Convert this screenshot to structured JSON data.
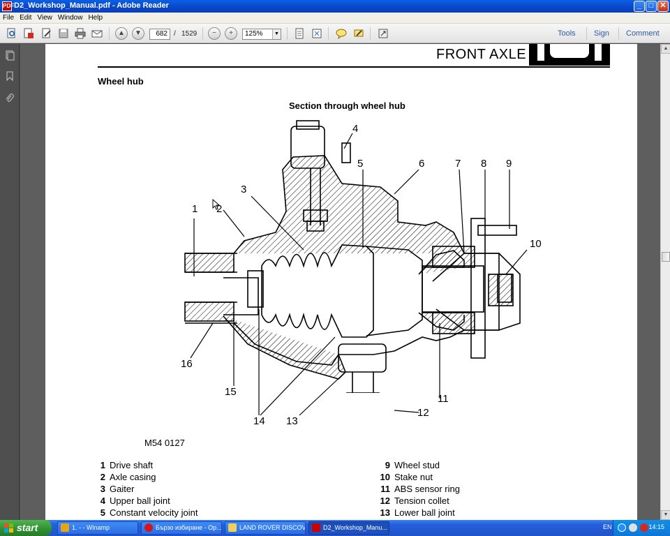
{
  "window": {
    "title": "D2_Workshop_Manual.pdf - Adobe Reader",
    "app_icon_label": "PDF",
    "controls": {
      "minimize": "_",
      "maximize": "□",
      "close": "✕"
    }
  },
  "menu": [
    "File",
    "Edit",
    "View",
    "Window",
    "Help"
  ],
  "toolbar": {
    "current_page": "682",
    "page_separator": "/",
    "total_pages": "1529",
    "zoom": "125%",
    "links": {
      "tools": "Tools",
      "sign": "Sign",
      "comment": "Comment"
    }
  },
  "page": {
    "section": "FRONT AXLE",
    "subheading": "Wheel hub",
    "figure_title": "Section through wheel hub",
    "figure_code": "M54 0127",
    "callouts": [
      "1",
      "2",
      "3",
      "4",
      "5",
      "6",
      "7",
      "8",
      "9",
      "10",
      "11",
      "12",
      "13",
      "14",
      "15",
      "16"
    ],
    "legend_left": [
      {
        "num": "1",
        "label": "Drive shaft"
      },
      {
        "num": "2",
        "label": "Axle casing"
      },
      {
        "num": "3",
        "label": "Gaiter"
      },
      {
        "num": "4",
        "label": "Upper ball joint"
      },
      {
        "num": "5",
        "label": "Constant velocity joint"
      }
    ],
    "legend_right": [
      {
        "num": "9",
        "label": "Wheel stud"
      },
      {
        "num": "10",
        "label": "Stake nut"
      },
      {
        "num": "11",
        "label": "ABS sensor ring"
      },
      {
        "num": "12",
        "label": "Tension collet"
      },
      {
        "num": "13",
        "label": "Lower ball joint"
      }
    ]
  },
  "taskbar": {
    "start_label": "start",
    "tasks": [
      {
        "label": "1.  -  - Winamp",
        "active": false
      },
      {
        "label": "Бързо избиране - Op...",
        "active": false
      },
      {
        "label": "LAND ROVER DISCOV...",
        "active": false
      },
      {
        "label": "D2_Workshop_Manu...",
        "active": true
      }
    ],
    "language": "EN",
    "clock": "14:15"
  },
  "colors": {
    "titlebar": "#0a46c8",
    "taskbar": "#245edb",
    "start_button": "#2f8f2f",
    "link": "#2c5aa0"
  },
  "icons": [
    "create-pdf-icon",
    "open-icon",
    "edit-icon",
    "save-icon",
    "print-icon",
    "email-icon",
    "prev-page-icon",
    "next-page-icon",
    "zoom-out-icon",
    "zoom-in-icon",
    "fit-page-icon",
    "full-screen-icon",
    "comment-icon",
    "highlight-icon",
    "expand-icon",
    "pages-panel-icon",
    "bookmarks-icon",
    "attachments-icon"
  ]
}
